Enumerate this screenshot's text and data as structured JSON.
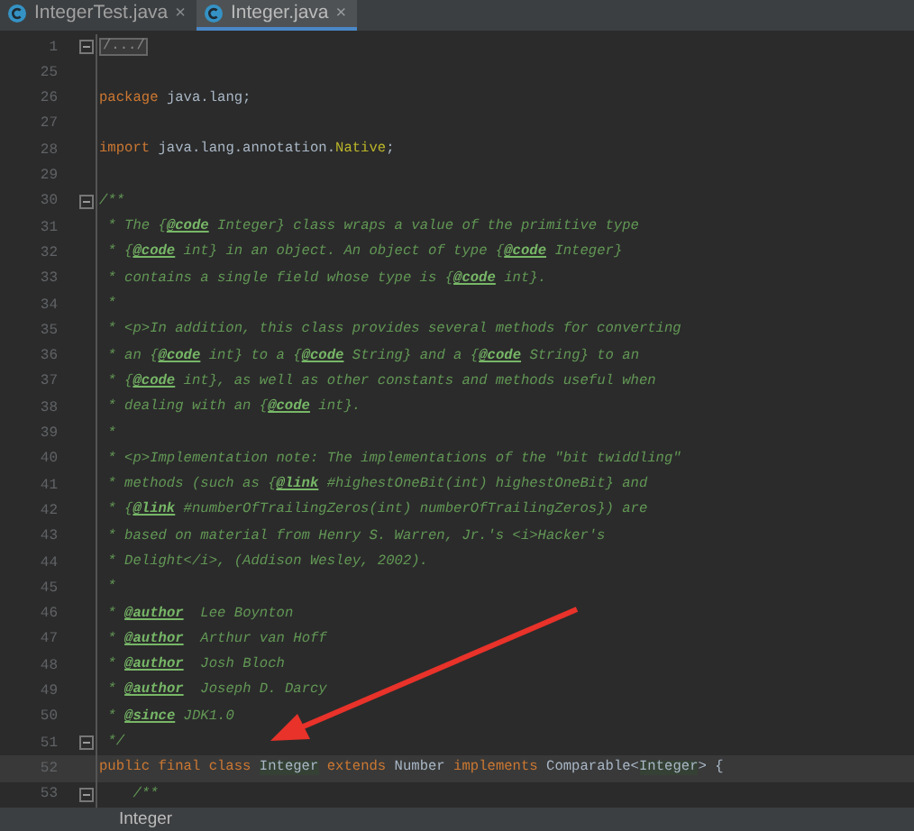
{
  "tabs": [
    {
      "label": "IntegerTest.java",
      "close": "×",
      "selected": false
    },
    {
      "label": "Integer.java",
      "close": "×",
      "selected": true
    }
  ],
  "lines": [
    {
      "number": "1",
      "fold": true,
      "current": false,
      "tokens": [
        {
          "kind": "folded",
          "text": "/.../"
        }
      ]
    },
    {
      "number": "25",
      "fold": false,
      "current": false
    },
    {
      "number": "26",
      "fold": false,
      "current": false,
      "tokens": [
        {
          "kind": "keyword",
          "text": "package"
        },
        {
          "kind": "plain",
          "text": " java.lang;"
        }
      ]
    },
    {
      "number": "27",
      "fold": false,
      "current": false
    },
    {
      "number": "28",
      "fold": false,
      "current": false,
      "tokens": [
        {
          "kind": "keyword",
          "text": "import"
        },
        {
          "kind": "plain",
          "text": " java.lang.annotation."
        },
        {
          "kind": "annotation",
          "text": "Native"
        },
        {
          "kind": "plain",
          "text": ";"
        }
      ]
    },
    {
      "number": "29",
      "fold": false,
      "current": false
    },
    {
      "number": "30",
      "fold": true,
      "current": false,
      "tokens": [
        {
          "kind": "comment",
          "text": "/**"
        }
      ]
    },
    {
      "number": "31",
      "fold": false,
      "current": false,
      "tokens": [
        {
          "kind": "comment",
          "text": " * The {"
        },
        {
          "kind": "tag",
          "text": "@code"
        },
        {
          "kind": "comment",
          "text": " Integer} class wraps a value of the primitive type"
        }
      ]
    },
    {
      "number": "32",
      "fold": false,
      "current": false,
      "tokens": [
        {
          "kind": "comment",
          "text": " * {"
        },
        {
          "kind": "tag",
          "text": "@code"
        },
        {
          "kind": "comment",
          "text": " int} in an object. An object of type {"
        },
        {
          "kind": "tag",
          "text": "@code"
        },
        {
          "kind": "comment",
          "text": " Integer}"
        }
      ]
    },
    {
      "number": "33",
      "fold": false,
      "current": false,
      "tokens": [
        {
          "kind": "comment",
          "text": " * contains a single field whose type is {"
        },
        {
          "kind": "tag",
          "text": "@code"
        },
        {
          "kind": "comment",
          "text": " int}."
        }
      ]
    },
    {
      "number": "34",
      "fold": false,
      "current": false,
      "tokens": [
        {
          "kind": "comment",
          "text": " *"
        }
      ]
    },
    {
      "number": "35",
      "fold": false,
      "current": false,
      "tokens": [
        {
          "kind": "comment",
          "text": " * <p>In addition, this class provides several methods for converting"
        }
      ]
    },
    {
      "number": "36",
      "fold": false,
      "current": false,
      "tokens": [
        {
          "kind": "comment",
          "text": " * an {"
        },
        {
          "kind": "tag",
          "text": "@code"
        },
        {
          "kind": "comment",
          "text": " int} to a {"
        },
        {
          "kind": "tag",
          "text": "@code"
        },
        {
          "kind": "comment",
          "text": " String} and a {"
        },
        {
          "kind": "tag",
          "text": "@code"
        },
        {
          "kind": "comment",
          "text": " String} to an"
        }
      ]
    },
    {
      "number": "37",
      "fold": false,
      "current": false,
      "tokens": [
        {
          "kind": "comment",
          "text": " * {"
        },
        {
          "kind": "tag",
          "text": "@code"
        },
        {
          "kind": "comment",
          "text": " int}, as well as other constants and methods useful when"
        }
      ]
    },
    {
      "number": "38",
      "fold": false,
      "current": false,
      "tokens": [
        {
          "kind": "comment",
          "text": " * dealing with an {"
        },
        {
          "kind": "tag",
          "text": "@code"
        },
        {
          "kind": "comment",
          "text": " int}."
        }
      ]
    },
    {
      "number": "39",
      "fold": false,
      "current": false,
      "tokens": [
        {
          "kind": "comment",
          "text": " *"
        }
      ]
    },
    {
      "number": "40",
      "fold": false,
      "current": false,
      "tokens": [
        {
          "kind": "comment",
          "text": " * <p>Implementation note: The implementations of the \"bit twiddling\""
        }
      ]
    },
    {
      "number": "41",
      "fold": false,
      "current": false,
      "tokens": [
        {
          "kind": "comment",
          "text": " * methods (such as {"
        },
        {
          "kind": "tag",
          "text": "@link"
        },
        {
          "kind": "comment",
          "text": " #highestOneBit(int) highestOneBit} and"
        }
      ]
    },
    {
      "number": "42",
      "fold": false,
      "current": false,
      "tokens": [
        {
          "kind": "comment",
          "text": " * {"
        },
        {
          "kind": "tag",
          "text": "@link"
        },
        {
          "kind": "comment",
          "text": " #numberOfTrailingZeros(int) numberOfTrailingZeros}) are"
        }
      ]
    },
    {
      "number": "43",
      "fold": false,
      "current": false,
      "tokens": [
        {
          "kind": "comment",
          "text": " * based on material from Henry S. Warren, Jr.'s <i>Hacker's"
        }
      ]
    },
    {
      "number": "44",
      "fold": false,
      "current": false,
      "tokens": [
        {
          "kind": "comment",
          "text": " * Delight</i>, (Addison Wesley, 2002)."
        }
      ]
    },
    {
      "number": "45",
      "fold": false,
      "current": false,
      "tokens": [
        {
          "kind": "comment",
          "text": " *"
        }
      ]
    },
    {
      "number": "46",
      "fold": false,
      "current": false,
      "tokens": [
        {
          "kind": "comment",
          "text": " * "
        },
        {
          "kind": "tag",
          "text": "@author"
        },
        {
          "kind": "comment",
          "text": "  Lee Boynton"
        }
      ]
    },
    {
      "number": "47",
      "fold": false,
      "current": false,
      "tokens": [
        {
          "kind": "comment",
          "text": " * "
        },
        {
          "kind": "tag",
          "text": "@author"
        },
        {
          "kind": "comment",
          "text": "  Arthur van Hoff"
        }
      ]
    },
    {
      "number": "48",
      "fold": false,
      "current": false,
      "tokens": [
        {
          "kind": "comment",
          "text": " * "
        },
        {
          "kind": "tag",
          "text": "@author"
        },
        {
          "kind": "comment",
          "text": "  Josh Bloch"
        }
      ]
    },
    {
      "number": "49",
      "fold": false,
      "current": false,
      "tokens": [
        {
          "kind": "comment",
          "text": " * "
        },
        {
          "kind": "tag",
          "text": "@author"
        },
        {
          "kind": "comment",
          "text": "  Joseph D. Darcy"
        }
      ]
    },
    {
      "number": "50",
      "fold": false,
      "current": false,
      "tokens": [
        {
          "kind": "comment",
          "text": " * "
        },
        {
          "kind": "tag",
          "text": "@since"
        },
        {
          "kind": "comment",
          "text": " JDK1.0"
        }
      ]
    },
    {
      "number": "51",
      "fold": true,
      "current": false,
      "tokens": [
        {
          "kind": "comment",
          "text": " */"
        }
      ]
    },
    {
      "number": "52",
      "fold": false,
      "current": true,
      "tokens": [
        {
          "kind": "keyword",
          "text": "public final class "
        },
        {
          "kind": "usage",
          "text": "Integer"
        },
        {
          "kind": "keyword",
          "text": " extends"
        },
        {
          "kind": "plain",
          "text": " Number "
        },
        {
          "kind": "keyword",
          "text": "implements"
        },
        {
          "kind": "plain",
          "text": " Comparable<"
        },
        {
          "kind": "usage",
          "text": "Integer"
        },
        {
          "kind": "plain",
          "text": "> {"
        }
      ]
    },
    {
      "number": "53",
      "fold": true,
      "current": false,
      "tokens": [
        {
          "kind": "comment",
          "text": "    /**"
        }
      ]
    }
  ],
  "status": "Integer"
}
